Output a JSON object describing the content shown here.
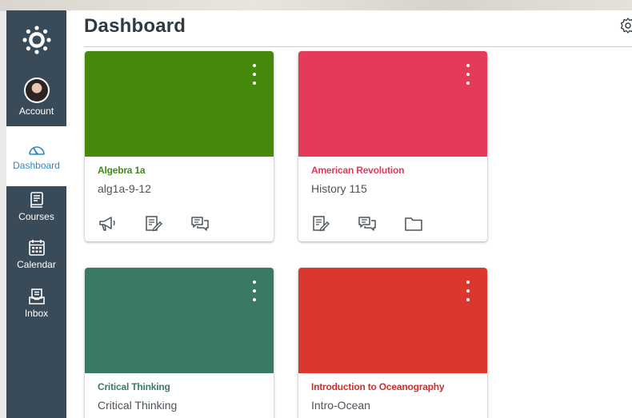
{
  "colors": {
    "sidebar_bg": "#394b58",
    "active_nav_text": "#2d8ac7",
    "algebra": "#468a0b",
    "american_revolution": "#e43b5b",
    "critical_thinking": "#3a7a62",
    "oceanography": "#da382e"
  },
  "nav": {
    "account": "Account",
    "dashboard": "Dashboard",
    "courses": "Courses",
    "calendar": "Calendar",
    "inbox": "Inbox"
  },
  "header": {
    "title": "Dashboard",
    "settings_icon": "gear-icon"
  },
  "courses": [
    {
      "title": "Algebra 1a",
      "code": "alg1a-9-12",
      "color": "#468a0b",
      "title_color": "#3d8c1a",
      "actions": [
        "announcements-icon",
        "assignments-icon",
        "discussions-icon"
      ]
    },
    {
      "title": "American Revolution",
      "code": "History 115",
      "color": "#e43b5b",
      "title_color": "#df3a5a",
      "actions": [
        "assignments-icon",
        "discussions-icon",
        "files-icon"
      ]
    },
    {
      "title": "Critical Thinking",
      "code": "Critical Thinking",
      "color": "#3a7a62",
      "title_color": "#3a7a62",
      "actions": []
    },
    {
      "title": "Introduction to Oceanography",
      "code": "Intro-Ocean",
      "color": "#da382e",
      "title_color": "#c8302c",
      "actions": []
    }
  ]
}
